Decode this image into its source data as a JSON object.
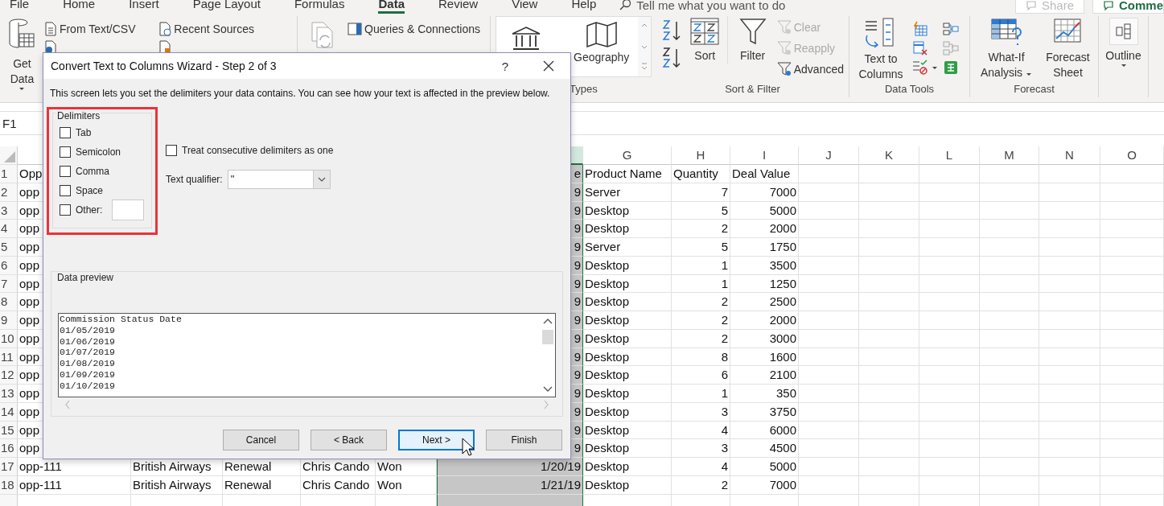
{
  "ribbon_tabs": [
    {
      "label": "File",
      "selected": false
    },
    {
      "label": "Home",
      "selected": false
    },
    {
      "label": "Insert",
      "selected": false
    },
    {
      "label": "Page Layout",
      "selected": false
    },
    {
      "label": "Formulas",
      "selected": false
    },
    {
      "label": "Data",
      "selected": true
    },
    {
      "label": "Review",
      "selected": false
    },
    {
      "label": "View",
      "selected": false
    },
    {
      "label": "Help",
      "selected": false
    }
  ],
  "tell_me": {
    "placeholder": "Tell me what you want to do"
  },
  "header_buttons": [
    {
      "label": "Share",
      "disabled": true
    },
    {
      "label": "Comme",
      "disabled": false
    }
  ],
  "ribbon": {
    "get_data": {
      "label": "Get Data"
    },
    "sources": [
      {
        "label": "From Text/CSV"
      },
      {
        "label": "Recent Sources"
      }
    ],
    "queries": {
      "label": "Queries & Connections"
    },
    "data_types": {
      "geography": "Geography",
      "group_label": "Types"
    },
    "sort_filter": {
      "sort": "Sort",
      "filter": "Filter",
      "options": [
        {
          "label": "Clear",
          "disabled": true
        },
        {
          "label": "Reapply",
          "disabled": true
        },
        {
          "label": "Advanced",
          "disabled": false
        }
      ],
      "group_label": "Sort & Filter"
    },
    "data_tools": {
      "text_to_columns": "Text to Columns",
      "group_label": "Data Tools"
    },
    "forecast": {
      "what_if": "What-If Analysis",
      "forecast_sheet": "Forecast Sheet",
      "group_label": "Forecast"
    },
    "outline": {
      "label": "Outline"
    }
  },
  "formula_bar": {
    "name_box": "F1"
  },
  "sheet": {
    "columns": [
      {
        "selected": true
      },
      {
        "label": "G",
        "selected": false
      },
      {
        "label": "H",
        "selected": false
      },
      {
        "label": "I",
        "selected": false
      },
      {
        "label": "J",
        "selected": false
      },
      {
        "label": "K",
        "selected": false
      },
      {
        "label": "L",
        "selected": false
      },
      {
        "label": "M",
        "selected": false
      },
      {
        "label": "N",
        "selected": false
      },
      {
        "label": "O",
        "selected": false
      }
    ],
    "rows": [
      {
        "number": "1",
        "kind": "header",
        "cells": {
          "a": "Opp",
          "f": "e",
          "g": "Product Name",
          "h": "Quantity",
          "i": "Deal Value"
        }
      },
      {
        "number": "2",
        "kind": "data",
        "cells": {
          "a": "opp",
          "f": "9",
          "g": "Server",
          "h": "7",
          "i": "7000"
        }
      },
      {
        "number": "3",
        "kind": "data",
        "cells": {
          "a": "opp",
          "f": "9",
          "g": "Desktop",
          "h": "5",
          "i": "5000"
        }
      },
      {
        "number": "4",
        "kind": "data",
        "cells": {
          "a": "opp",
          "f": "9",
          "g": "Desktop",
          "h": "2",
          "i": "2000"
        }
      },
      {
        "number": "5",
        "kind": "data",
        "cells": {
          "a": "opp",
          "f": "9",
          "g": "Server",
          "h": "5",
          "i": "1750"
        }
      },
      {
        "number": "6",
        "kind": "data",
        "cells": {
          "a": "opp",
          "f": "9",
          "g": "Desktop",
          "h": "1",
          "i": "3500"
        }
      },
      {
        "number": "7",
        "kind": "data",
        "cells": {
          "a": "opp",
          "f": "9",
          "g": "Desktop",
          "h": "1",
          "i": "1250"
        }
      },
      {
        "number": "8",
        "kind": "data",
        "cells": {
          "a": "opp",
          "f": "9",
          "g": "Desktop",
          "h": "2",
          "i": "2500"
        }
      },
      {
        "number": "9",
        "kind": "data",
        "cells": {
          "a": "opp",
          "f": "9",
          "g": "Desktop",
          "h": "2",
          "i": "2000"
        }
      },
      {
        "number": "10",
        "kind": "data",
        "cells": {
          "a": "opp",
          "f": "9",
          "g": "Desktop",
          "h": "2",
          "i": "3000"
        }
      },
      {
        "number": "11",
        "kind": "data",
        "cells": {
          "a": "opp",
          "f": "9",
          "g": "Desktop",
          "h": "8",
          "i": "1600"
        }
      },
      {
        "number": "12",
        "kind": "data",
        "cells": {
          "a": "opp",
          "f": "9",
          "g": "Desktop",
          "h": "6",
          "i": "2100"
        }
      },
      {
        "number": "13",
        "kind": "data",
        "cells": {
          "a": "opp",
          "f": "9",
          "g": "Desktop",
          "h": "1",
          "i": "350"
        }
      },
      {
        "number": "14",
        "kind": "data",
        "cells": {
          "a": "opp",
          "f": "9",
          "g": "Desktop",
          "h": "3",
          "i": "3750"
        }
      },
      {
        "number": "15",
        "kind": "data",
        "cells": {
          "a": "opp",
          "f": "9",
          "g": "Desktop",
          "h": "4",
          "i": "6000"
        }
      },
      {
        "number": "16",
        "kind": "data",
        "cells": {
          "a": "opp",
          "f": "9",
          "g": "Desktop",
          "h": "3",
          "i": "4500"
        }
      },
      {
        "number": "17",
        "kind": "data",
        "cells": {
          "a": "opp-111",
          "b": "British Airways",
          "c": "Renewal",
          "d": "Chris Cando",
          "e": "Won",
          "f": "1/20/19",
          "g": "Desktop",
          "h": "4",
          "i": "5000"
        }
      },
      {
        "number": "18",
        "kind": "data",
        "cells": {
          "a": "opp-111",
          "b": "British Airways",
          "c": "Renewal",
          "d": "Chris Cando",
          "e": "Won",
          "f": "1/21/19",
          "g": "Desktop",
          "h": "2",
          "i": "7000"
        }
      },
      {
        "kind": "blank"
      }
    ]
  },
  "dialog": {
    "title": "Convert Text to Columns Wizard - Step 2 of 3",
    "help": "?",
    "description": "This screen lets you set the delimiters your data contains.  You can see how your text is affected in the preview below.",
    "delimiters": {
      "legend": "Delimiters",
      "options": [
        {
          "label": "Tab",
          "checked": false,
          "kind": "plain"
        },
        {
          "label": "Semicolon",
          "checked": false,
          "kind": "plain"
        },
        {
          "label": "Comma",
          "checked": false,
          "kind": "plain"
        },
        {
          "label": "Space",
          "checked": false,
          "kind": "plain"
        },
        {
          "label": "Other:",
          "checked": false,
          "kind": "with_field"
        }
      ]
    },
    "treat_consecutive": {
      "label": "Treat consecutive delimiters as one",
      "checked": false
    },
    "text_qualifier": {
      "label": "Text qualifier:",
      "value": "\""
    },
    "preview": {
      "legend": "Data preview",
      "lines": [
        "Commission Status Date",
        "01/05/2019",
        "01/06/2019",
        "01/07/2019",
        "01/08/2019",
        "01/09/2019",
        "01/10/2019"
      ]
    },
    "buttons": [
      {
        "label": "Cancel",
        "focused": false
      },
      {
        "label": "< Back",
        "focused": false
      },
      {
        "label": "Next >",
        "focused": true
      },
      {
        "label": "Finish",
        "focused": false
      }
    ]
  }
}
